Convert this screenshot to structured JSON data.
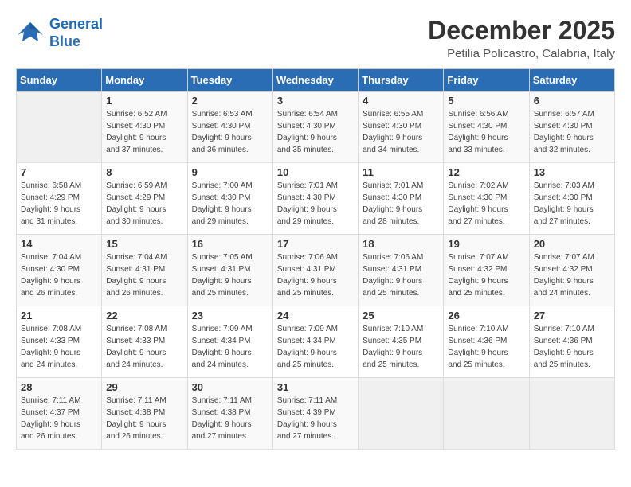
{
  "logo": {
    "line1": "General",
    "line2": "Blue"
  },
  "title": "December 2025",
  "location": "Petilia Policastro, Calabria, Italy",
  "days_header": [
    "Sunday",
    "Monday",
    "Tuesday",
    "Wednesday",
    "Thursday",
    "Friday",
    "Saturday"
  ],
  "weeks": [
    [
      {
        "num": "",
        "info": ""
      },
      {
        "num": "1",
        "info": "Sunrise: 6:52 AM\nSunset: 4:30 PM\nDaylight: 9 hours\nand 37 minutes."
      },
      {
        "num": "2",
        "info": "Sunrise: 6:53 AM\nSunset: 4:30 PM\nDaylight: 9 hours\nand 36 minutes."
      },
      {
        "num": "3",
        "info": "Sunrise: 6:54 AM\nSunset: 4:30 PM\nDaylight: 9 hours\nand 35 minutes."
      },
      {
        "num": "4",
        "info": "Sunrise: 6:55 AM\nSunset: 4:30 PM\nDaylight: 9 hours\nand 34 minutes."
      },
      {
        "num": "5",
        "info": "Sunrise: 6:56 AM\nSunset: 4:30 PM\nDaylight: 9 hours\nand 33 minutes."
      },
      {
        "num": "6",
        "info": "Sunrise: 6:57 AM\nSunset: 4:30 PM\nDaylight: 9 hours\nand 32 minutes."
      }
    ],
    [
      {
        "num": "7",
        "info": "Sunrise: 6:58 AM\nSunset: 4:29 PM\nDaylight: 9 hours\nand 31 minutes."
      },
      {
        "num": "8",
        "info": "Sunrise: 6:59 AM\nSunset: 4:29 PM\nDaylight: 9 hours\nand 30 minutes."
      },
      {
        "num": "9",
        "info": "Sunrise: 7:00 AM\nSunset: 4:30 PM\nDaylight: 9 hours\nand 29 minutes."
      },
      {
        "num": "10",
        "info": "Sunrise: 7:01 AM\nSunset: 4:30 PM\nDaylight: 9 hours\nand 29 minutes."
      },
      {
        "num": "11",
        "info": "Sunrise: 7:01 AM\nSunset: 4:30 PM\nDaylight: 9 hours\nand 28 minutes."
      },
      {
        "num": "12",
        "info": "Sunrise: 7:02 AM\nSunset: 4:30 PM\nDaylight: 9 hours\nand 27 minutes."
      },
      {
        "num": "13",
        "info": "Sunrise: 7:03 AM\nSunset: 4:30 PM\nDaylight: 9 hours\nand 27 minutes."
      }
    ],
    [
      {
        "num": "14",
        "info": "Sunrise: 7:04 AM\nSunset: 4:30 PM\nDaylight: 9 hours\nand 26 minutes."
      },
      {
        "num": "15",
        "info": "Sunrise: 7:04 AM\nSunset: 4:31 PM\nDaylight: 9 hours\nand 26 minutes."
      },
      {
        "num": "16",
        "info": "Sunrise: 7:05 AM\nSunset: 4:31 PM\nDaylight: 9 hours\nand 25 minutes."
      },
      {
        "num": "17",
        "info": "Sunrise: 7:06 AM\nSunset: 4:31 PM\nDaylight: 9 hours\nand 25 minutes."
      },
      {
        "num": "18",
        "info": "Sunrise: 7:06 AM\nSunset: 4:31 PM\nDaylight: 9 hours\nand 25 minutes."
      },
      {
        "num": "19",
        "info": "Sunrise: 7:07 AM\nSunset: 4:32 PM\nDaylight: 9 hours\nand 25 minutes."
      },
      {
        "num": "20",
        "info": "Sunrise: 7:07 AM\nSunset: 4:32 PM\nDaylight: 9 hours\nand 24 minutes."
      }
    ],
    [
      {
        "num": "21",
        "info": "Sunrise: 7:08 AM\nSunset: 4:33 PM\nDaylight: 9 hours\nand 24 minutes."
      },
      {
        "num": "22",
        "info": "Sunrise: 7:08 AM\nSunset: 4:33 PM\nDaylight: 9 hours\nand 24 minutes."
      },
      {
        "num": "23",
        "info": "Sunrise: 7:09 AM\nSunset: 4:34 PM\nDaylight: 9 hours\nand 24 minutes."
      },
      {
        "num": "24",
        "info": "Sunrise: 7:09 AM\nSunset: 4:34 PM\nDaylight: 9 hours\nand 25 minutes."
      },
      {
        "num": "25",
        "info": "Sunrise: 7:10 AM\nSunset: 4:35 PM\nDaylight: 9 hours\nand 25 minutes."
      },
      {
        "num": "26",
        "info": "Sunrise: 7:10 AM\nSunset: 4:36 PM\nDaylight: 9 hours\nand 25 minutes."
      },
      {
        "num": "27",
        "info": "Sunrise: 7:10 AM\nSunset: 4:36 PM\nDaylight: 9 hours\nand 25 minutes."
      }
    ],
    [
      {
        "num": "28",
        "info": "Sunrise: 7:11 AM\nSunset: 4:37 PM\nDaylight: 9 hours\nand 26 minutes."
      },
      {
        "num": "29",
        "info": "Sunrise: 7:11 AM\nSunset: 4:38 PM\nDaylight: 9 hours\nand 26 minutes."
      },
      {
        "num": "30",
        "info": "Sunrise: 7:11 AM\nSunset: 4:38 PM\nDaylight: 9 hours\nand 27 minutes."
      },
      {
        "num": "31",
        "info": "Sunrise: 7:11 AM\nSunset: 4:39 PM\nDaylight: 9 hours\nand 27 minutes."
      },
      {
        "num": "",
        "info": ""
      },
      {
        "num": "",
        "info": ""
      },
      {
        "num": "",
        "info": ""
      }
    ]
  ]
}
